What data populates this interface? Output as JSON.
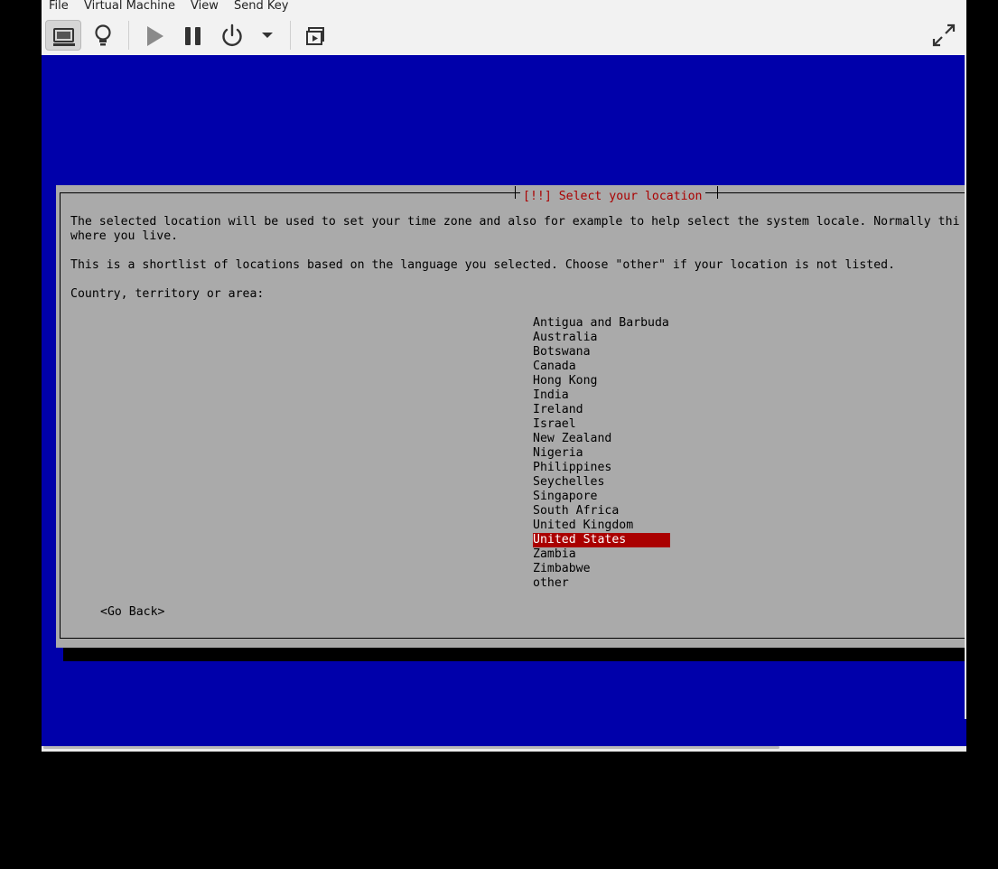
{
  "menubar": {
    "items": [
      "File",
      "Virtual Machine",
      "View",
      "Send Key"
    ]
  },
  "toolbar": {
    "buttons": [
      {
        "name": "show-console-icon",
        "active": true
      },
      {
        "name": "details-lightbulb-icon",
        "active": false
      },
      {
        "name": "run-play-icon",
        "active": false
      },
      {
        "name": "pause-icon",
        "active": false
      },
      {
        "name": "power-icon",
        "active": false
      },
      {
        "name": "dropdown-arrow-icon",
        "active": false
      },
      {
        "name": "snapshots-icon",
        "active": false
      },
      {
        "name": "fullscreen-icon",
        "active": false
      }
    ]
  },
  "installer": {
    "title": "[!!] Select your location",
    "paragraph1_line1": "The selected location will be used to set your time zone and also for example to help select the system locale. Normally thi",
    "paragraph1_line2": "where you live.",
    "paragraph2": "This is a shortlist of locations based on the language you selected. Choose \"other\" if your location is not listed.",
    "prompt": "Country, territory or area:",
    "locations": [
      "Antigua and Barbuda",
      "Australia",
      "Botswana",
      "Canada",
      "Hong Kong",
      "India",
      "Ireland",
      "Israel",
      "New Zealand",
      "Nigeria",
      "Philippines",
      "Seychelles",
      "Singapore",
      "South Africa",
      "United Kingdom",
      "United States",
      "Zambia",
      "Zimbabwe",
      "other"
    ],
    "selected_location": "United States",
    "go_back_label": "<Go Back>"
  },
  "colors": {
    "screen_background": "#0000aa",
    "dialog_background": "#aaaaaa",
    "title_color": "#aa0000",
    "selection_background": "#aa0000",
    "selection_text": "#ffffff"
  }
}
